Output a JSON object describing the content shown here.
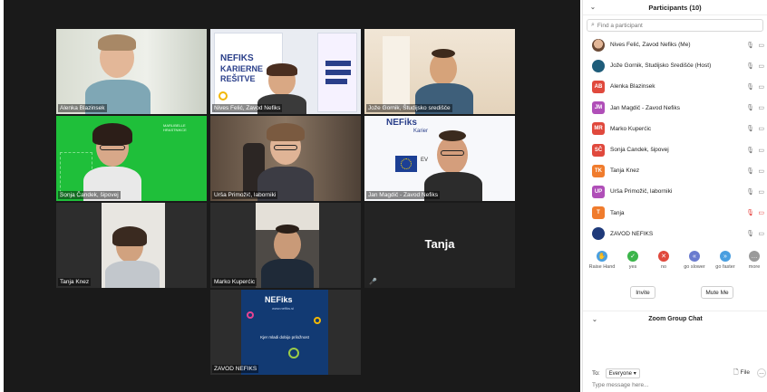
{
  "tiles": [
    {
      "name": "Alenka Blazinsek",
      "active": true
    },
    {
      "name": "Nives Felić, Zavod Nefiks"
    },
    {
      "name": "Jože Gornik, Študijsko središče"
    },
    {
      "name": "Sonja Čandek, šipovej"
    },
    {
      "name": "Urša Primožič, laborniki"
    },
    {
      "name": "Jan Magdič - Zavod Nefiks"
    },
    {
      "name": "Tanja Knez"
    },
    {
      "name": "Marko Kuperćic"
    },
    {
      "name": "Tanja",
      "video_off": true
    },
    {
      "name": "ZAVOD NEFIKS"
    }
  ],
  "poster": {
    "title": "NEFIKS",
    "line1": "KARIERNE",
    "line2": "REŠITVE"
  },
  "nefiks_slide": {
    "logo": "NEFiks",
    "subtitle": "Karier",
    "tagline": "EV"
  },
  "nefiks_tile": {
    "logo": "NEFiks",
    "url": "www.nefiks.si",
    "tagline": "Kjer mladi dobijo priložnost"
  },
  "green_slide": {
    "text": "MARLIBELLE HRASTNIKCE"
  },
  "panel": {
    "title": "Participants (10)",
    "search_placeholder": "Find a participant",
    "participants": [
      {
        "initials": "",
        "name": "Nives Felić, Zavod Nefiks (Me)",
        "color": "#c98a6c",
        "photo": true
      },
      {
        "initials": "",
        "name": "Jože Gornik, Študijsko Središče (Host)",
        "color": "#1f5d7a",
        "logo": true
      },
      {
        "initials": "AB",
        "name": "Alenka Blazinsek",
        "color": "#e0493d"
      },
      {
        "initials": "JM",
        "name": "Jan Magdič - Zavod Nefiks",
        "color": "#b04fb8"
      },
      {
        "initials": "MR",
        "name": "Marko Kuperćic",
        "color": "#e0493d"
      },
      {
        "initials": "SČ",
        "name": "Sonja Čandek, šipovej",
        "color": "#e0493d"
      },
      {
        "initials": "TK",
        "name": "Tanja Knez",
        "color": "#f07c2d"
      },
      {
        "initials": "UP",
        "name": "Urša Primožič, laborniki",
        "color": "#b04fb8"
      },
      {
        "initials": "T",
        "name": "Tanja",
        "color": "#f07c2d",
        "muted": true
      },
      {
        "initials": "",
        "name": "ZAVOD NEFIKS",
        "color": "#1f3a7a",
        "logo": true
      }
    ],
    "reactions": [
      {
        "label": "Raise Hand",
        "icon": "✋",
        "color": "#4a9fe0"
      },
      {
        "label": "yes",
        "icon": "✓",
        "color": "#3bb54a"
      },
      {
        "label": "no",
        "icon": "✕",
        "color": "#e0493d"
      },
      {
        "label": "go slower",
        "icon": "«",
        "color": "#6a7bcf"
      },
      {
        "label": "go faster",
        "icon": "»",
        "color": "#4a9fe0"
      },
      {
        "label": "more",
        "icon": "…",
        "color": "#9a9a9a"
      }
    ],
    "invite_label": "Invite",
    "mute_me_label": "Mute Me"
  },
  "chat": {
    "title": "Zoom Group Chat",
    "to_label": "To:",
    "to_value": "Everyone",
    "file_label": "File",
    "input_placeholder": "Type message here..."
  },
  "colors": {
    "active_border": "#9ccc47",
    "green_bg": "#1fbf3a",
    "nefiks_blue": "#123a73"
  }
}
